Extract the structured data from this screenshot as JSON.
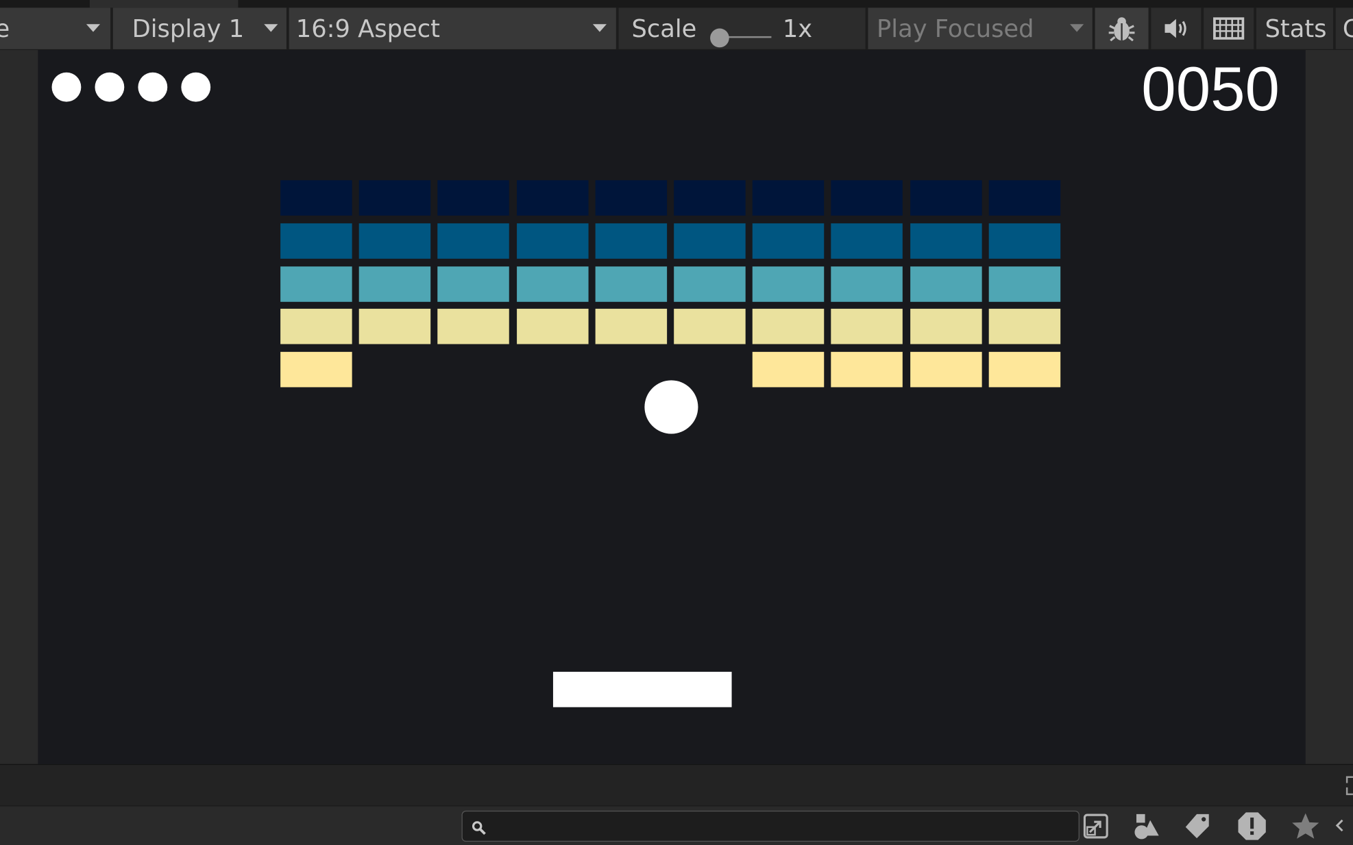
{
  "toolbar": {
    "display_label": "Display 1",
    "aspect_label": "16:9 Aspect",
    "scale_label": "Scale",
    "scale_value": "1x",
    "scale_slider_value": 0,
    "play_mode_label": "Play Focused",
    "stats_label": "Stats",
    "icons": [
      "bug-icon",
      "audio-icon",
      "keyboard-icon"
    ]
  },
  "game": {
    "score": "0050",
    "lives": 4,
    "brick_colors": [
      "#00153a",
      "#005681",
      "#4fa6b4",
      "#eae19e",
      "#fee79a"
    ],
    "brick_rows": [
      [
        1,
        1,
        1,
        1,
        1,
        1,
        1,
        1,
        1,
        1
      ],
      [
        1,
        1,
        1,
        1,
        1,
        1,
        1,
        1,
        1,
        1
      ],
      [
        1,
        1,
        1,
        1,
        1,
        1,
        1,
        1,
        1,
        1
      ],
      [
        1,
        1,
        1,
        1,
        1,
        1,
        1,
        1,
        1,
        1
      ],
      [
        1,
        0,
        0,
        0,
        0,
        0,
        1,
        1,
        1,
        1
      ]
    ]
  },
  "bottom": {
    "search_placeholder": "",
    "icons": [
      "maximize-icon",
      "shapes-icon",
      "tag-icon",
      "warning-icon",
      "star-icon"
    ]
  }
}
